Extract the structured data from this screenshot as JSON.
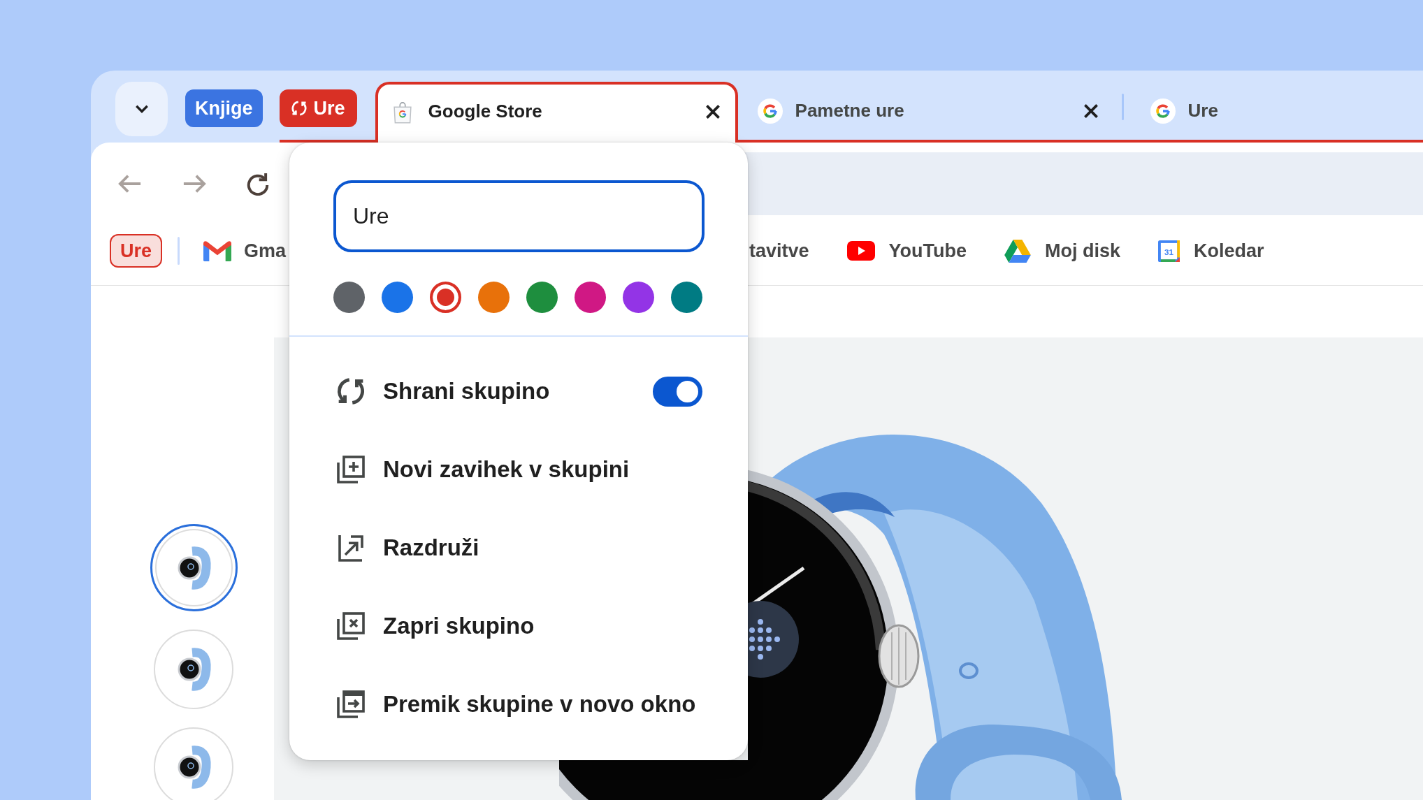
{
  "tab_strip": {
    "groups": [
      {
        "label": "Knjige",
        "color": "#3b74e1",
        "saved": false
      },
      {
        "label": "Ure",
        "color": "#d93025",
        "saved": true,
        "tabs": [
          {
            "kind": "store",
            "title": "Google Store",
            "selected": true,
            "closable": true
          },
          {
            "kind": "google",
            "title": "Pametne ure",
            "selected": false,
            "closable": true
          },
          {
            "kind": "google",
            "title": "Ure",
            "selected": false,
            "closable": false
          }
        ]
      }
    ]
  },
  "toolbar": {
    "buttons": [
      {
        "kind": "back",
        "disabled": true
      },
      {
        "kind": "forward",
        "disabled": true
      },
      {
        "kind": "reload",
        "disabled": false
      }
    ]
  },
  "bookmarks_bar": {
    "saved_groups": [
      {
        "label": "Ure",
        "color": "#d93025"
      }
    ],
    "bookmarks": [
      {
        "kind": "gmail",
        "label": "Gma"
      },
      {
        "label": "tavitve"
      },
      {
        "kind": "youtube",
        "label": "YouTube"
      },
      {
        "kind": "drive",
        "label": "Moj disk"
      },
      {
        "kind": "calendar",
        "label": "Koledar",
        "date": "31"
      }
    ]
  },
  "menu": {
    "name_field": {
      "value": "Ure"
    },
    "colors": [
      {
        "color": "#5f6368",
        "selected": false
      },
      {
        "color": "#1a73e8",
        "selected": false
      },
      {
        "color": "#d93025",
        "selected": true
      },
      {
        "color": "#e8710a",
        "selected": false
      },
      {
        "color": "#1e8e3e",
        "selected": false
      },
      {
        "color": "#d01884",
        "selected": false
      },
      {
        "color": "#9334e6",
        "selected": false
      },
      {
        "color": "#007b83",
        "selected": false
      }
    ],
    "items": [
      {
        "kind": "save",
        "label": "Shrani skupino",
        "toggle": {
          "on": true
        }
      },
      {
        "kind": "add",
        "label": "Novi zavihek v skupini"
      },
      {
        "kind": "ungroup",
        "label": "Razdruži"
      },
      {
        "kind": "close",
        "label": "Zapri skupino"
      },
      {
        "kind": "move",
        "label": "Premik skupine v novo okno"
      }
    ]
  },
  "product_page": {
    "thumbnails": [
      {
        "selected": true
      },
      {
        "selected": false
      },
      {
        "selected": false
      }
    ]
  }
}
